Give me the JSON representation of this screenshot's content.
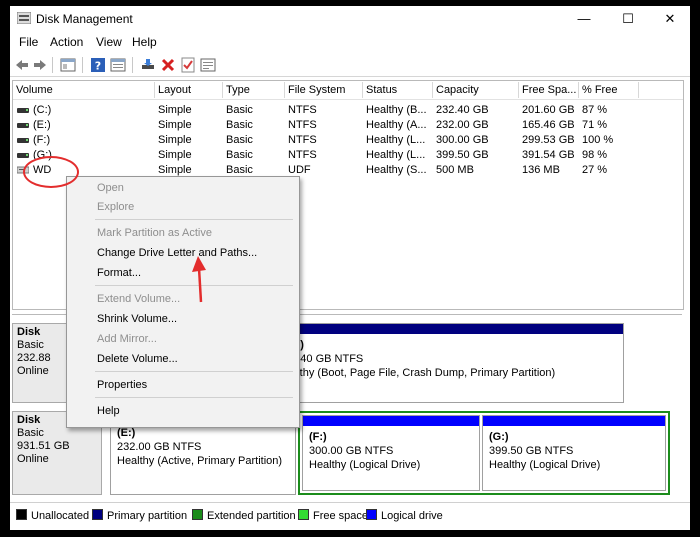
{
  "window": {
    "title": "Disk Management",
    "controls": {
      "minimize": "—",
      "maximize": "☐",
      "close": "✕"
    }
  },
  "menubar": [
    "File",
    "Action",
    "View",
    "Help"
  ],
  "toolbar_icons": [
    "back-arrow-icon",
    "forward-arrow-icon",
    "console-tree-icon",
    "help-icon",
    "properties-icon",
    "connect-drive-icon",
    "delete-icon",
    "check-icon",
    "list-icon"
  ],
  "volume_table": {
    "columns": [
      "Volume",
      "Layout",
      "Type",
      "File System",
      "Status",
      "Capacity",
      "Free Spa...",
      "% Free"
    ],
    "rows": [
      {
        "volume": "(C:)",
        "layout": "Simple",
        "type": "Basic",
        "fs": "NTFS",
        "status": "Healthy (B...",
        "capacity": "232.40 GB",
        "free": "201.60 GB",
        "pct": "87 %"
      },
      {
        "volume": "(E:)",
        "layout": "Simple",
        "type": "Basic",
        "fs": "NTFS",
        "status": "Healthy (A...",
        "capacity": "232.00 GB",
        "free": "165.46 GB",
        "pct": "71 %"
      },
      {
        "volume": "(F:)",
        "layout": "Simple",
        "type": "Basic",
        "fs": "NTFS",
        "status": "Healthy (L...",
        "capacity": "300.00 GB",
        "free": "299.53 GB",
        "pct": "100 %"
      },
      {
        "volume": "(G:)",
        "layout": "Simple",
        "type": "Basic",
        "fs": "NTFS",
        "status": "Healthy (L...",
        "capacity": "399.50 GB",
        "free": "391.54 GB",
        "pct": "98 %"
      },
      {
        "volume": "WD",
        "layout": "Simple",
        "type": "Basic",
        "fs": "UDF",
        "status": "Healthy (S...",
        "capacity": "500 MB",
        "free": "136 MB",
        "pct": "27 %"
      }
    ]
  },
  "context_menu": {
    "items": [
      {
        "label": "Open",
        "enabled": false
      },
      {
        "label": "Explore",
        "enabled": false
      },
      {
        "label": "Mark Partition as Active",
        "enabled": false
      },
      {
        "label": "Change Drive Letter and Paths...",
        "enabled": true
      },
      {
        "label": "Format...",
        "enabled": true
      },
      {
        "label": "Extend Volume...",
        "enabled": false
      },
      {
        "label": "Shrink Volume...",
        "enabled": true
      },
      {
        "label": "Add Mirror...",
        "enabled": false
      },
      {
        "label": "Delete Volume...",
        "enabled": true
      },
      {
        "label": "Properties",
        "enabled": true
      },
      {
        "label": "Help",
        "enabled": true
      }
    ]
  },
  "disks": [
    {
      "label": "Disk",
      "type": "Basic",
      "size": "232.88",
      "state": "Online",
      "partitions": [
        {
          "letter": "(C:)",
          "size": "32.40 GB NTFS",
          "status": "ealthy (Boot, Page File, Crash Dump, Primary Partition)"
        }
      ]
    },
    {
      "label": "Disk",
      "type": "Basic",
      "size": "931.51 GB",
      "state": "Online",
      "partitions": [
        {
          "letter": "(E:)",
          "size": "232.00 GB NTFS",
          "status": "Healthy (Active, Primary Partition)"
        },
        {
          "letter": "(F:)",
          "size": "300.00 GB NTFS",
          "status": "Healthy (Logical Drive)"
        },
        {
          "letter": "(G:)",
          "size": "399.50 GB NTFS",
          "status": "Healthy (Logical Drive)"
        }
      ]
    }
  ],
  "legend": [
    {
      "label": "Unallocated",
      "color": "#000000"
    },
    {
      "label": "Primary partition",
      "color": "#00007f"
    },
    {
      "label": "Extended partition",
      "color": "#1b8c1b"
    },
    {
      "label": "Free space",
      "color": "#33dd33"
    },
    {
      "label": "Logical drive",
      "color": "#0000ff"
    }
  ]
}
